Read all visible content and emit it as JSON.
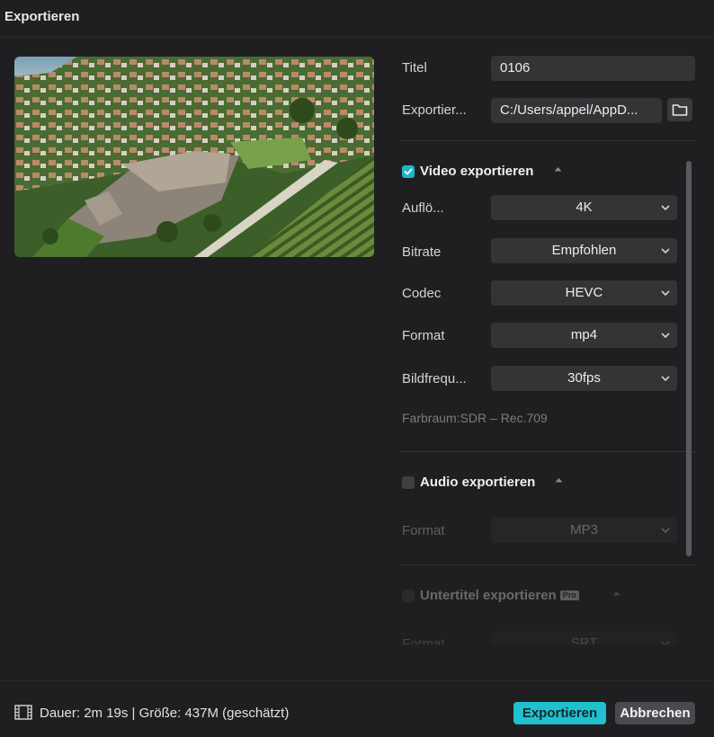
{
  "window": {
    "title": "Exportieren"
  },
  "preview": {
    "alt": "aerial-landscape-thumbnail"
  },
  "fields": {
    "title_label": "Titel",
    "title_value": "0106",
    "export_path_label": "Exportier...",
    "export_path_value": "C:/Users/appel/AppD..."
  },
  "video": {
    "section_label": "Video exportieren",
    "checked": true,
    "resolution_label": "Auflö...",
    "resolution_value": "4K",
    "bitrate_label": "Bitrate",
    "bitrate_value": "Empfohlen",
    "codec_label": "Codec",
    "codec_value": "HEVC",
    "format_label": "Format",
    "format_value": "mp4",
    "framerate_label": "Bildfrequ...",
    "framerate_value": "30fps",
    "colorspace_text": "Farbraum:SDR – Rec.709"
  },
  "audio": {
    "section_label": "Audio exportieren",
    "checked": false,
    "format_label": "Format",
    "format_value": "MP3"
  },
  "subtitles": {
    "section_label": "Untertitel exportieren",
    "badge": "Pro",
    "format_label": "Format",
    "format_value": "SRT"
  },
  "footer": {
    "info": "Dauer: 2m 19s | Größe: 437M (geschätzt)",
    "export_button": "Exportieren",
    "cancel_button": "Abbrechen"
  },
  "colors": {
    "accent": "#1fc0cf",
    "background": "#1f1f21",
    "field": "#343437"
  },
  "icons": [
    "folder-icon",
    "chevron-down-icon",
    "caret-up-icon",
    "checkmark-icon",
    "film-icon"
  ]
}
